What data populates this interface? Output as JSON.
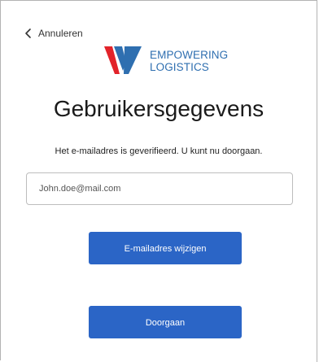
{
  "nav": {
    "back_label": "Annuleren",
    "back_icon": "chevron-left-icon"
  },
  "logo": {
    "line1": "EMPOWERING",
    "line2": "LOGISTICS",
    "colors": {
      "red": "#e2232a",
      "blue": "#2f6fb0"
    }
  },
  "page": {
    "title": "Gebruikersgegevens",
    "message": "Het e-mailadres is geverifieerd. U kunt nu doorgaan."
  },
  "email": {
    "value": "John.doe@mail.com"
  },
  "buttons": {
    "change_email": "E-mailadres wijzigen",
    "continue": "Doorgaan"
  },
  "colors": {
    "primary": "#2b65c6"
  }
}
